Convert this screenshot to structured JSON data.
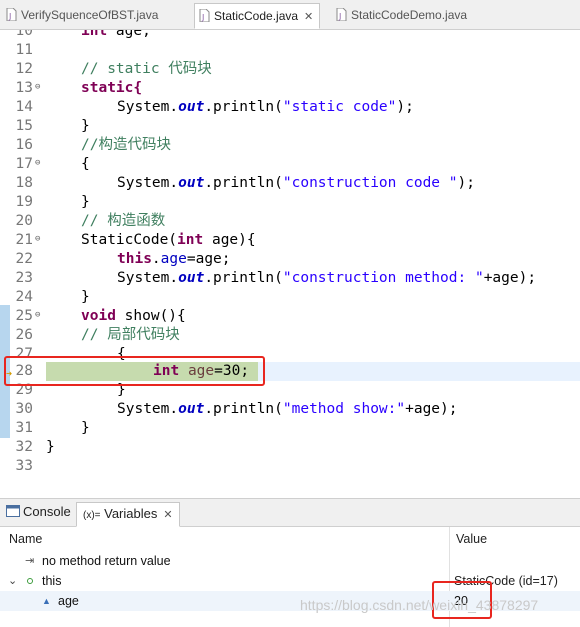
{
  "editor_tabs": [
    {
      "label": "VerifySquenceOfBST.java",
      "active": false
    },
    {
      "label": "StaticCode.java",
      "active": true
    },
    {
      "label": "StaticCodeDemo.java",
      "active": false
    }
  ],
  "close_glyph": "✕",
  "code_lines": [
    {
      "num": "10",
      "text": "int age;"
    },
    {
      "num": "11",
      "text": ""
    },
    {
      "num": "12",
      "text": "// static 代码块"
    },
    {
      "num": "13",
      "text": "static{"
    },
    {
      "num": "14",
      "text": "System.out.println(\"static code\");"
    },
    {
      "num": "15",
      "text": "}"
    },
    {
      "num": "16",
      "text": "//构造代码块"
    },
    {
      "num": "17",
      "text": "{"
    },
    {
      "num": "18",
      "text": "System.out.println(\"construction code \");"
    },
    {
      "num": "19",
      "text": "}"
    },
    {
      "num": "20",
      "text": "// 构造函数"
    },
    {
      "num": "21",
      "text": "StaticCode(int age){"
    },
    {
      "num": "22",
      "text": "this.age=age;"
    },
    {
      "num": "23",
      "text": "System.out.println(\"construction method: \"+age);"
    },
    {
      "num": "24",
      "text": "}"
    },
    {
      "num": "25",
      "text": "void show(){"
    },
    {
      "num": "26",
      "text": "// 局部代码块"
    },
    {
      "num": "27",
      "text": "{"
    },
    {
      "num": "28",
      "text": "int age=30;"
    },
    {
      "num": "29",
      "text": "}"
    },
    {
      "num": "30",
      "text": "System.out.println(\"method show:\"+age);"
    },
    {
      "num": "31",
      "text": "}"
    },
    {
      "num": "32",
      "text": "}"
    },
    {
      "num": "33",
      "text": ""
    }
  ],
  "bottom_tabs": [
    {
      "label": "Console",
      "active": false
    },
    {
      "label": "Variables",
      "prefix": "(x)=",
      "active": true
    }
  ],
  "variables": {
    "columns": [
      "Name",
      "Value"
    ],
    "rows": [
      {
        "name": "no method return value",
        "value": ""
      },
      {
        "name": "this",
        "value": "StaticCode  (id=17)"
      },
      {
        "name": "age",
        "value": "20"
      }
    ]
  },
  "watermark": "https://blog.csdn.net/weixin_43878297",
  "colors": {
    "highlight_box": "#e8261f",
    "current_line": "#c6dbae",
    "keyword": "#7f0055",
    "comment": "#3f7f5f",
    "string": "#2a00ff"
  }
}
